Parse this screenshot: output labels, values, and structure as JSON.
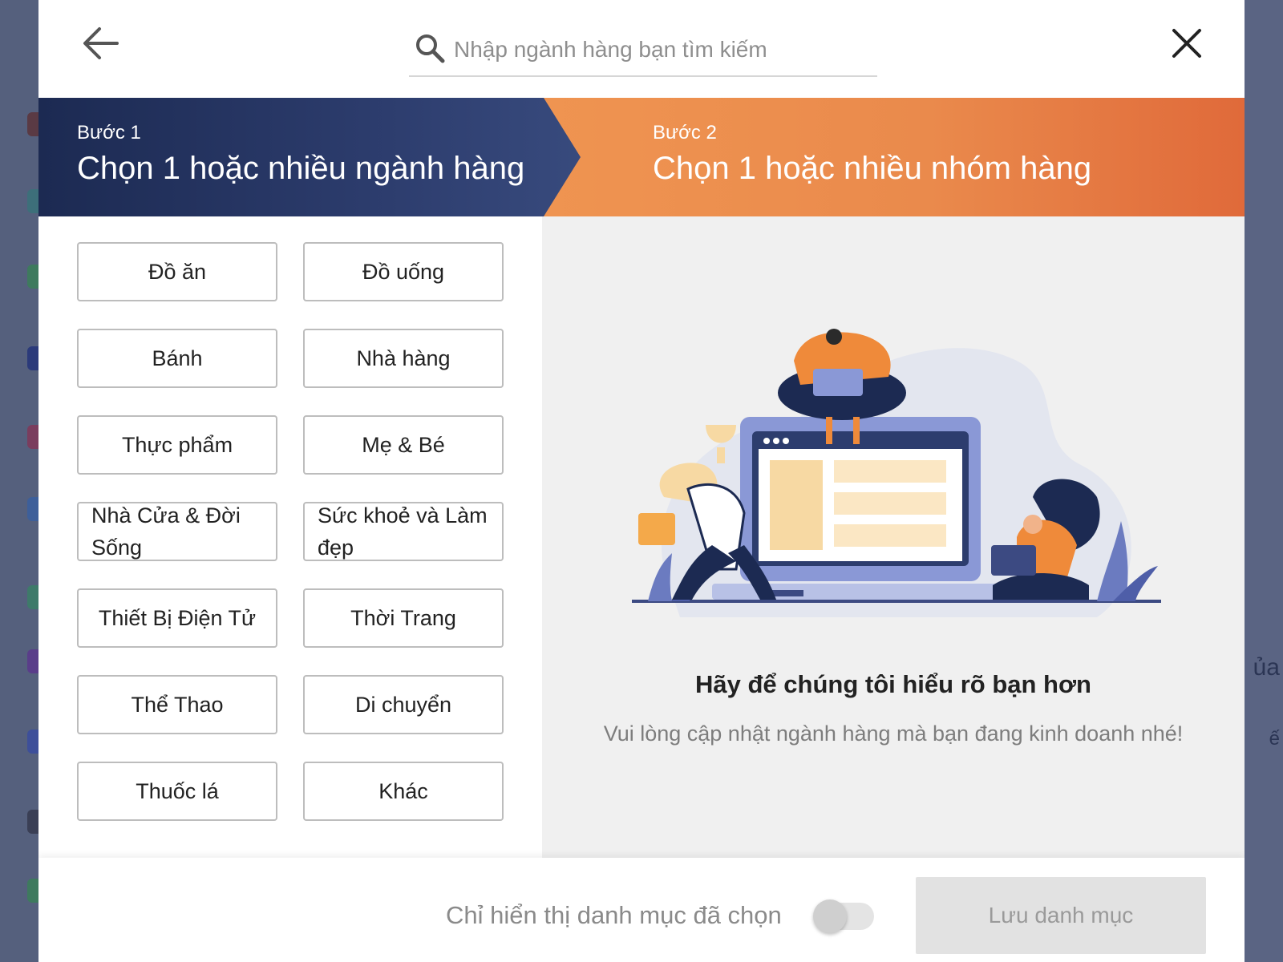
{
  "search": {
    "placeholder": "Nhập ngành hàng bạn tìm kiếm"
  },
  "steps": [
    {
      "small": "Bước 1",
      "title": "Chọn 1 hoặc nhiều ngành hàng"
    },
    {
      "small": "Bước 2",
      "title": "Chọn 1 hoặc nhiều nhóm hàng"
    }
  ],
  "categories": [
    "Đồ ăn",
    "Đồ uống",
    "Bánh",
    "Nhà hàng",
    "Thực phẩm",
    "Mẹ & Bé",
    "Nhà Cửa & Đời Sống",
    "Sức khoẻ và Làm đẹp",
    "Thiết Bị Điện Tử",
    "Thời Trang",
    "Thể Thao",
    "Di chuyển",
    "Thuốc lá",
    "Khác"
  ],
  "hint": {
    "title": "Hãy để chúng tôi hiểu rõ bạn hơn",
    "subtitle": "Vui lòng cập nhật ngành hàng mà bạn đang kinh doanh nhé!"
  },
  "footer": {
    "filter_label": "Chỉ hiển thị danh mục đã chọn",
    "filter_on": false,
    "save_label": "Lưu danh mục"
  },
  "background": {
    "partial_texts": [
      "ủa",
      "ế"
    ]
  },
  "colors": {
    "step1": "#1c2a52",
    "step2": "#ea8a4c",
    "accent_orange": "#ef8a3a"
  }
}
